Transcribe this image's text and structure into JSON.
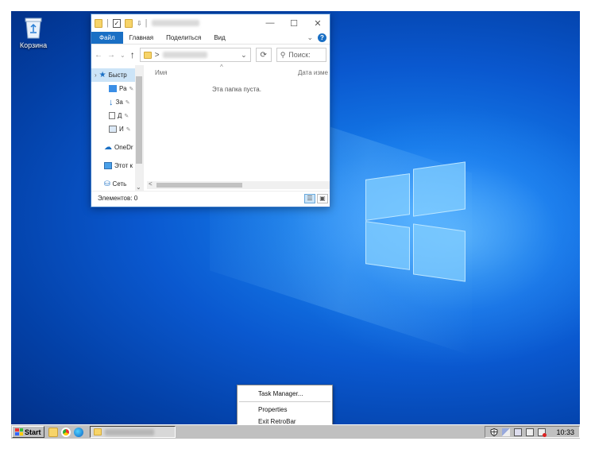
{
  "desktop": {
    "recycle_bin_label": "Корзина"
  },
  "explorer": {
    "title_separator": "|",
    "window_buttons": {
      "minimize": "—",
      "maximize": "☐",
      "close": "✕"
    },
    "ribbon_tabs": [
      "Файл",
      "Главная",
      "Поделиться",
      "Вид"
    ],
    "ribbon_collapse": "⌄",
    "help_label": "?",
    "nav": {
      "back": "←",
      "forward": "→",
      "up": "↑"
    },
    "address_prefix": ">",
    "address_dropdown": "⌄",
    "refresh_label": "⟳",
    "search_placeholder": "Поиск:",
    "nav_pane": [
      {
        "label": "Быстр",
        "pin": ""
      },
      {
        "label": "Ра",
        "pin": "✎"
      },
      {
        "label": "За",
        "pin": "✎"
      },
      {
        "label": "Д",
        "pin": "✎"
      },
      {
        "label": "И",
        "pin": "✎"
      },
      {
        "label": "OneDr",
        "pin": ""
      },
      {
        "label": "Этот к",
        "pin": ""
      },
      {
        "label": "Сеть",
        "pin": ""
      }
    ],
    "columns": {
      "name": "Имя",
      "date": "Дата изме"
    },
    "sort_arrow": "^",
    "empty_text": "Эта папка пуста.",
    "status_text": "Элементов: 0",
    "hscroll_left": "<",
    "navscroll_down": "⌄"
  },
  "context_menu": {
    "items": [
      "Task Manager...",
      "Properties",
      "Exit RetroBar"
    ]
  },
  "taskbar": {
    "start_label": "Start",
    "clock": "10:33"
  },
  "colors": {
    "accent": "#1a6fc4",
    "taskbar": "#c0c0c0",
    "desktop_blue": "#0a58cf"
  }
}
